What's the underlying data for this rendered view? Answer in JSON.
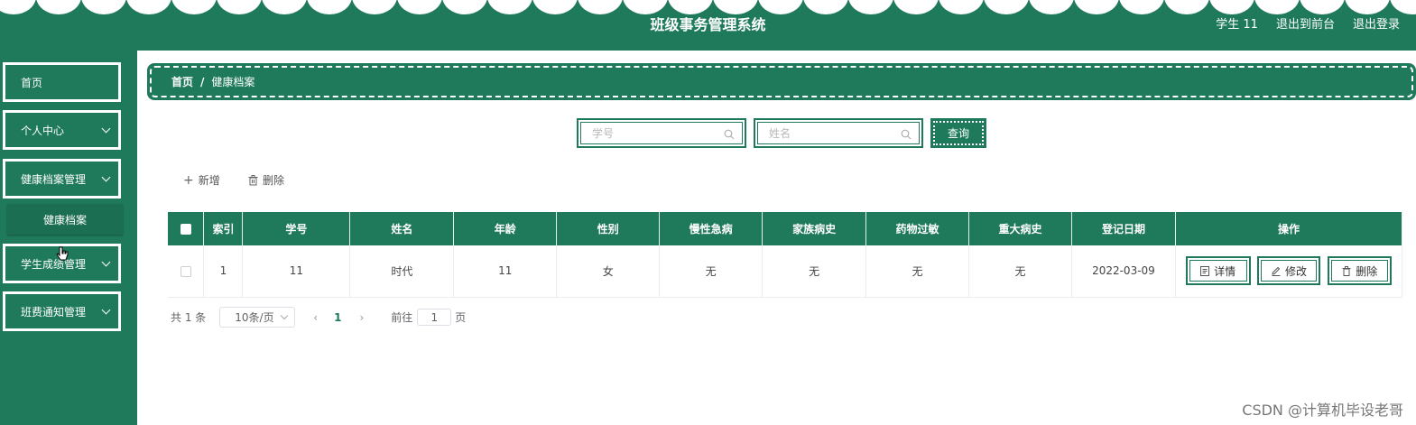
{
  "header": {
    "title": "班级事务管理系统",
    "user": "学生 11",
    "to_front": "退出到前台",
    "logout": "退出登录"
  },
  "sidebar": {
    "items": [
      {
        "label": "首页"
      },
      {
        "label": "个人中心"
      },
      {
        "label": "健康档案管理"
      },
      {
        "label": "学生成绩管理"
      },
      {
        "label": "班费通知管理"
      }
    ],
    "sub_item": "健康档案"
  },
  "breadcrumb": {
    "home": "首页",
    "sep": "/",
    "current": "健康档案"
  },
  "search": {
    "student_no_placeholder": "学号",
    "name_placeholder": "姓名",
    "query_label": "查询"
  },
  "toolbar": {
    "add_label": "新增",
    "delete_label": "删除"
  },
  "table": {
    "columns": [
      "索引",
      "学号",
      "姓名",
      "年龄",
      "性别",
      "慢性急病",
      "家族病史",
      "药物过敏",
      "重大病史",
      "登记日期",
      "操作"
    ],
    "rows": [
      {
        "index": "1",
        "student_no": "11",
        "name": "时代",
        "age": "11",
        "gender": "女",
        "chronic": "无",
        "family": "无",
        "allergy": "无",
        "major": "无",
        "date": "2022-03-09"
      }
    ],
    "actions": {
      "detail": "详情",
      "edit": "修改",
      "delete": "删除"
    }
  },
  "pagination": {
    "total": "共 1 条",
    "page_size": "10条/页",
    "prev": "‹",
    "current_page": "1",
    "next": "›",
    "goto_label": "前往",
    "goto_value": "1",
    "page_unit": "页"
  },
  "watermark": "CSDN @计算机毕设老哥",
  "colors": {
    "primary": "#1f7a5c",
    "primary_dark": "#1b6e52",
    "white": "#ffffff"
  }
}
